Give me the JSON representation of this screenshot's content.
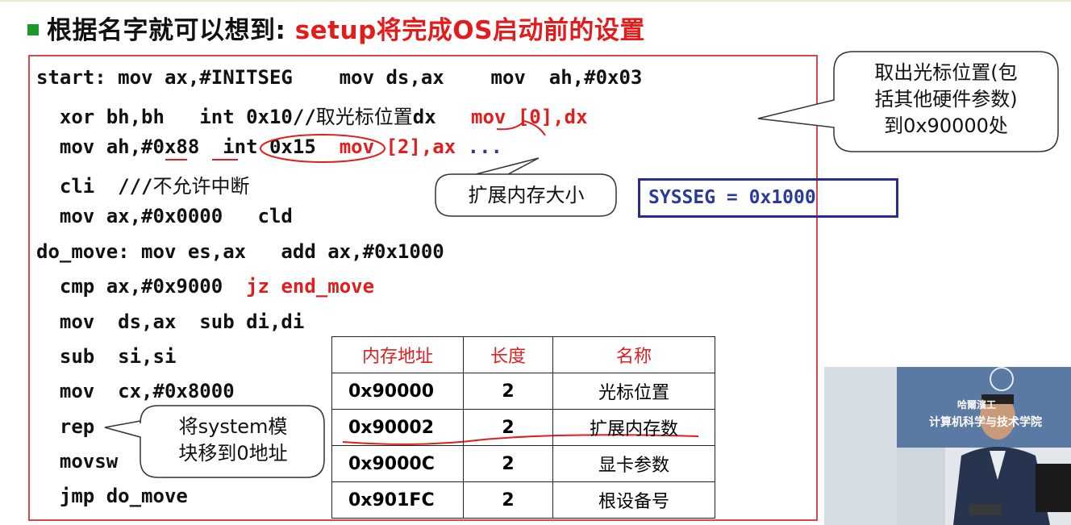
{
  "title": {
    "prefix": "根据名字就可以想到: ",
    "highlight": "setup将完成OS启动前的设置"
  },
  "code": {
    "l1": {
      "main": "start: mov ax,#INITSEG    mov ds,ax    mov  ah,#0x03"
    },
    "l2": {
      "a": "  xor bh,bh   int 0x10//",
      "cn": "取光标位置",
      "b": "dx   ",
      "red": "mov [0],dx"
    },
    "l3": {
      "a": "  mov ah,#0x88  int 0x15  ",
      "red": "mov [2],ax",
      "blue": " ..."
    },
    "l4": {
      "a": "  cli  ///",
      "cn": "不允许中断"
    },
    "l5": {
      "a": "  mov ax,#0x0000   cld"
    },
    "l6": {
      "a": "do_move: mov es,ax   add ax,#0x1000"
    },
    "l7": {
      "a": "  cmp ax,#0x9000  ",
      "red": "jz end_move"
    },
    "l8": {
      "a": "  mov  ds,ax  sub di,di"
    },
    "l9": {
      "a": "  sub  si,si"
    },
    "l10": {
      "a": "  mov  cx,#0x8000"
    },
    "l11": {
      "a": "  rep"
    },
    "l12": {
      "a": "  movsw"
    },
    "l13": {
      "a": "  jmp do_move"
    }
  },
  "callouts": {
    "cursor": [
      "取出光标位置(包",
      "括其他硬件参数)",
      "到0x90000处"
    ],
    "extmem": "扩展内存大小",
    "move": [
      "将system模",
      "块移到0地址"
    ]
  },
  "sysseg": "SYSSEG = 0x1000",
  "table": {
    "headers": [
      "内存地址",
      "长度",
      "名称"
    ],
    "rows": [
      [
        "0x90000",
        "2",
        "光标位置"
      ],
      [
        "0x90002",
        "2",
        "扩展内存数"
      ],
      [
        "0x9000C",
        "2",
        "显卡参数"
      ],
      [
        "0x901FC",
        "2",
        "根设备号"
      ]
    ]
  },
  "video": {
    "logo": "哈爾濱工",
    "label": "计算机科学与技术学院"
  }
}
